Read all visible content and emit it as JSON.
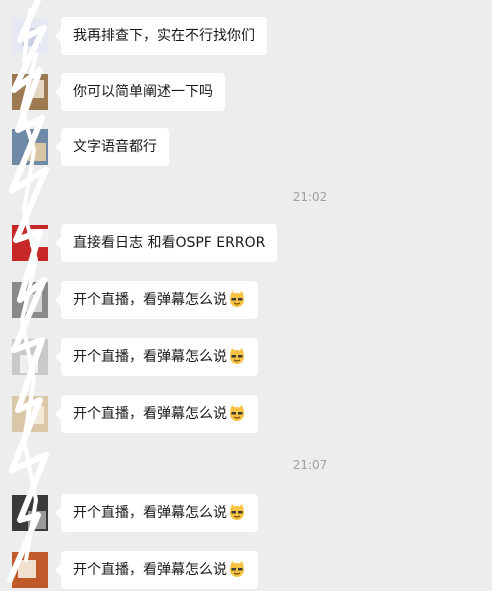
{
  "messages": [
    {
      "text": "我再排查下，实在不行找你们",
      "emoji": false,
      "avatar_colors": [
        "#e7e9f2",
        "#c9cfe3"
      ]
    },
    {
      "text": "你可以简单阐述一下吗",
      "emoji": false,
      "avatar_colors": [
        "#9c7a52",
        "#e4d6c2"
      ]
    },
    {
      "text": "文字语音都行",
      "emoji": false,
      "avatar_colors": [
        "#6f8aa6",
        "#d9c6a4"
      ]
    },
    {
      "text": "直接看日志 和看OSPF ERROR",
      "emoji": false,
      "avatar_colors": [
        "#c62828",
        "#f1f1f1"
      ]
    },
    {
      "text": "开个直播，看弹幕怎么说",
      "emoji": true,
      "avatar_colors": [
        "#8a8a8a",
        "#d6d6d6"
      ]
    },
    {
      "text": "开个直播，看弹幕怎么说",
      "emoji": true,
      "avatar_colors": [
        "#c9c9c9",
        "#efefef"
      ]
    },
    {
      "text": "开个直播，看弹幕怎么说",
      "emoji": true,
      "avatar_colors": [
        "#d9c7a8",
        "#f2e9d9"
      ]
    },
    {
      "text": "开个直播，看弹幕怎么说",
      "emoji": true,
      "avatar_colors": [
        "#3a3a3a",
        "#9a9a9a"
      ]
    },
    {
      "text": "开个直播，看弹幕怎么说",
      "emoji": true,
      "avatar_colors": [
        "#c05a2a",
        "#f0e0d0"
      ]
    }
  ],
  "timestamps": [
    "21:02",
    "21:07"
  ],
  "emoji_name": "cat-face-emoji",
  "colors": {
    "background": "#ededed",
    "bubble": "#ffffff",
    "text": "#191919",
    "timestamp": "#a0a0a0"
  }
}
